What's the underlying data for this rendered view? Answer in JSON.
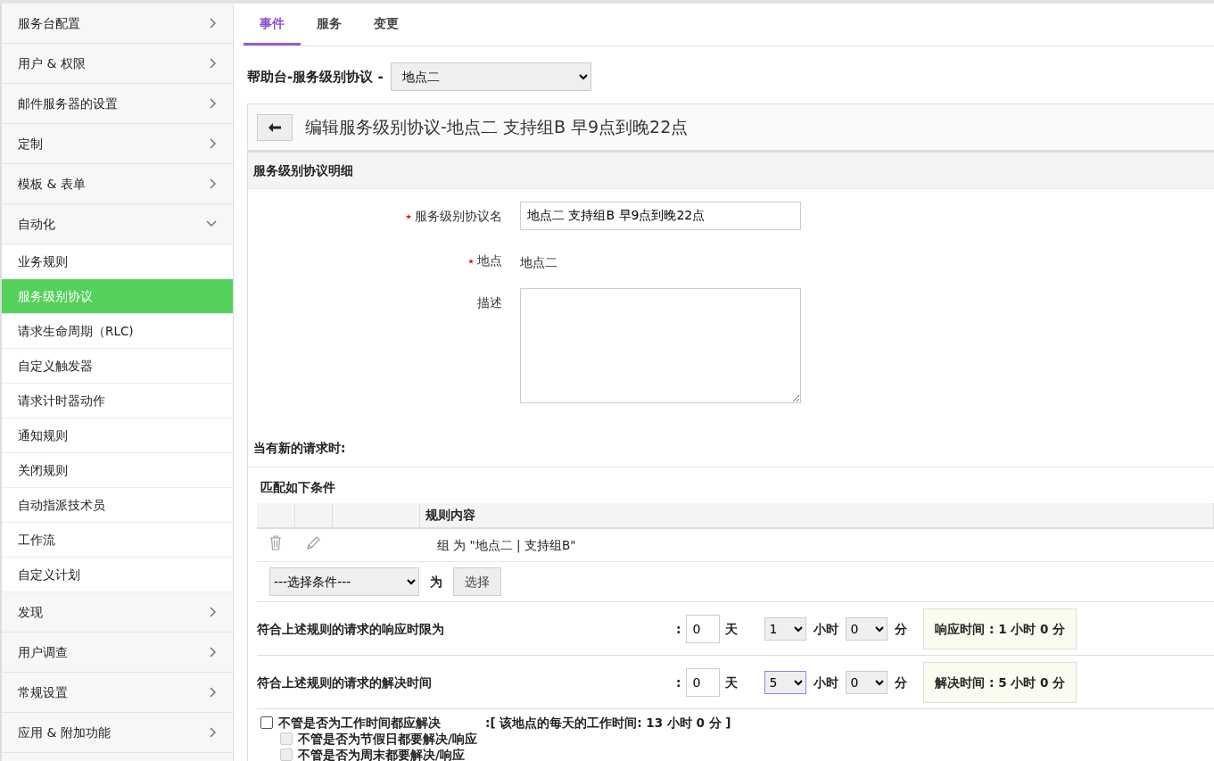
{
  "sidebar": {
    "items": [
      {
        "label": "服务台配置",
        "expanded": false
      },
      {
        "label": "用户 & 权限",
        "expanded": false
      },
      {
        "label": "邮件服务器的设置",
        "expanded": false
      },
      {
        "label": "定制",
        "expanded": false
      },
      {
        "label": "模板 & 表单",
        "expanded": false
      },
      {
        "label": "自动化",
        "expanded": true,
        "children": [
          {
            "label": "业务规则",
            "selected": false
          },
          {
            "label": "服务级别协议",
            "selected": true
          },
          {
            "label": "请求生命周期（RLC)",
            "selected": false
          },
          {
            "label": "自定义触发器",
            "selected": false
          },
          {
            "label": "请求计时器动作",
            "selected": false
          },
          {
            "label": "通知规则",
            "selected": false
          },
          {
            "label": "关闭规则",
            "selected": false
          },
          {
            "label": "自动指派技术员",
            "selected": false
          },
          {
            "label": "工作流",
            "selected": false
          },
          {
            "label": "自定义计划",
            "selected": false
          }
        ]
      },
      {
        "label": "发现",
        "expanded": false
      },
      {
        "label": "用户调查",
        "expanded": false
      },
      {
        "label": "常规设置",
        "expanded": false
      },
      {
        "label": "应用 & 附加功能",
        "expanded": false
      }
    ]
  },
  "tabs": [
    {
      "label": "事件",
      "selected": true
    },
    {
      "label": "服务",
      "selected": false
    },
    {
      "label": "变更",
      "selected": false
    }
  ],
  "header": {
    "title": "帮助台-服务级别协议 -",
    "location": "地点二"
  },
  "panel": {
    "title": "编辑服务级别协议-地点二 支持组B 早9点到晚22点"
  },
  "details": {
    "heading": "服务级别协议明细",
    "fields": [
      {
        "label": "服务级别协议名",
        "required": true,
        "kind": "input",
        "value": "地点二 支持组B 早9点到晚22点"
      },
      {
        "label": "地点",
        "required": true,
        "kind": "text",
        "value": "地点二"
      },
      {
        "label": "描述",
        "required": false,
        "kind": "textarea"
      }
    ]
  },
  "conditions": {
    "heading": "当有新的请求时:",
    "subheading": "匹配如下条件",
    "columns": [
      "规则内容"
    ],
    "rows": [
      {
        "text": "组 为 \"地点二 | 支持组B\""
      }
    ],
    "condition_select": "---选择条件---",
    "is_label": "为",
    "select_button": "选择"
  },
  "times": [
    {
      "label": "符合上述规则的请求的响应时限为",
      "colon": ":",
      "days": "0",
      "day_unit": "天",
      "hours": "1",
      "hour_unit": "小时",
      "minutes": "0",
      "minute_unit": "分",
      "summary": "响应时间 : 1 小时 0 分",
      "focused": false
    },
    {
      "label": "符合上述规则的请求的解决时间",
      "colon": ":",
      "days": "0",
      "day_unit": "天",
      "hours": "5",
      "hour_unit": "小时",
      "minutes": "0",
      "minute_unit": "分",
      "summary": "解决时间 : 5 小时 0 分",
      "focused": true
    }
  ],
  "options": [
    {
      "label": "不管是否为工作时间都应解决",
      "checked": false,
      "disabled": false,
      "note": ":[ 该地点的每天的工作时间:  13 小时 0 分 ]"
    },
    {
      "label": "不管是否为节假日都要解决/响应",
      "checked": false,
      "disabled": true
    },
    {
      "label": "不管是否为周末都要解决/响应",
      "checked": false,
      "disabled": true
    }
  ]
}
